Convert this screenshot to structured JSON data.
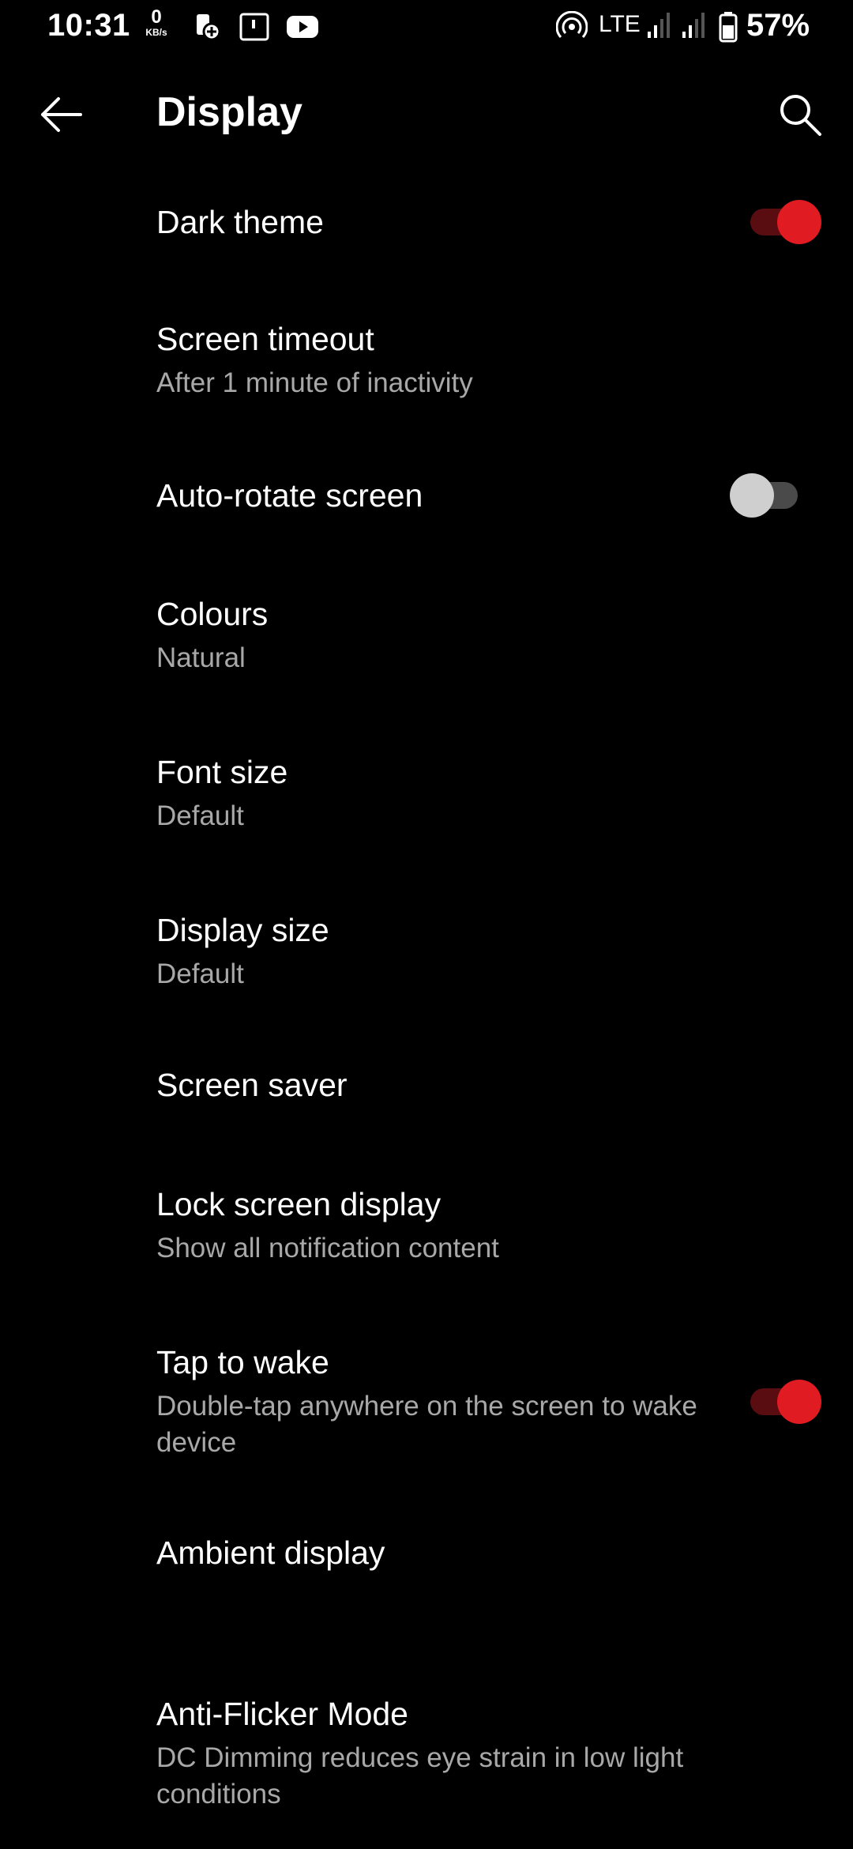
{
  "status_bar": {
    "time": "10:31",
    "net_speed_value": "0",
    "net_speed_unit": "KB/s",
    "network": "LTE",
    "battery": "57%"
  },
  "app_bar": {
    "title": "Display"
  },
  "settings": [
    {
      "label": "Dark theme",
      "toggle": true
    },
    {
      "label": "Screen timeout",
      "summary": "After 1 minute of inactivity"
    },
    {
      "label": "Auto-rotate screen",
      "toggle": false
    },
    {
      "label": "Colours",
      "summary": "Natural"
    },
    {
      "label": "Font size",
      "summary": "Default"
    },
    {
      "label": "Display size",
      "summary": "Default"
    },
    {
      "label": "Screen saver"
    },
    {
      "label": "Lock screen display",
      "summary": "Show all notification content"
    },
    {
      "label": "Tap to wake",
      "summary": "Double-tap anywhere on the screen to wake device",
      "toggle": true
    },
    {
      "label": "Ambient display"
    },
    {
      "label": "Anti-Flicker Mode",
      "summary": "DC Dimming reduces eye strain in low light conditions"
    }
  ],
  "colors": {
    "accent": "#e11b22",
    "background": "#000000",
    "secondary_text": "#a8a8a8"
  }
}
